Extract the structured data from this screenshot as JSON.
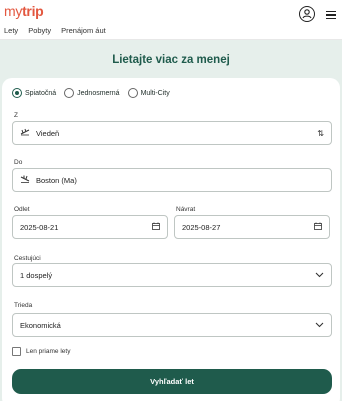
{
  "brand": {
    "logo_my": "my",
    "logo_trip": "trip"
  },
  "nav": {
    "items": [
      "Lety",
      "Pobyty",
      "Prenájom áut"
    ]
  },
  "icons": {
    "user": "user-icon",
    "menu": "hamburger-menu-icon",
    "swap": "swap-arrows-icon",
    "plane_depart": "plane-depart-icon",
    "plane_arrive": "plane-arrive-icon",
    "calendar": "calendar-icon",
    "chevron": "chevron-down-icon"
  },
  "headline": "Lietajte viac za menej",
  "trip_type": {
    "options": [
      "Spiatočná",
      "Jednosmerná",
      "Multi-City"
    ],
    "selected": "Spiatočná"
  },
  "from": {
    "label": "Z",
    "value": "Viedeň"
  },
  "to": {
    "label": "Do",
    "value": "Boston (Ma)"
  },
  "depart": {
    "label": "Odlet",
    "value": "2025-08-21"
  },
  "return": {
    "label": "Návrat",
    "value": "2025-08-27"
  },
  "passengers": {
    "label": "Cestujúci",
    "value": "1 dospelý"
  },
  "cabin": {
    "label": "Trieda",
    "value": "Ekonomická"
  },
  "direct_only": {
    "label": "Len priame lety",
    "checked": false
  },
  "search_button": "Vyhľadať let",
  "colors": {
    "brand": "#e3573f",
    "primary": "#1f5b4c",
    "background": "#e6efeb"
  }
}
